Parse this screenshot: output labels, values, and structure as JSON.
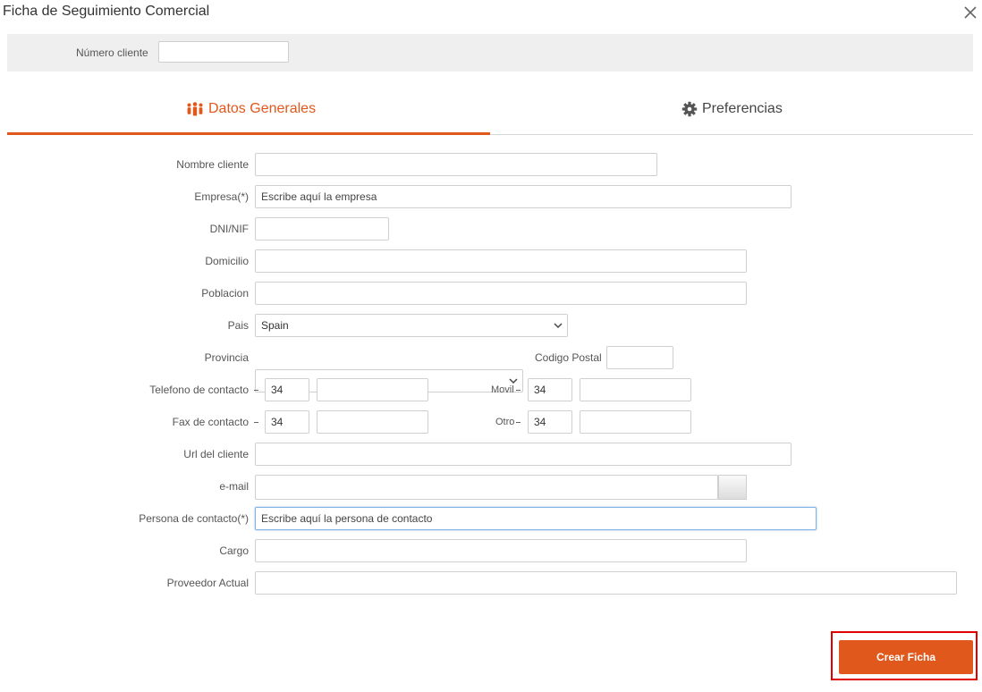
{
  "dialog": {
    "title": "Ficha de Seguimiento Comercial",
    "close_icon": "close-icon"
  },
  "client_search": {
    "label": "Número cliente",
    "value": ""
  },
  "tabs": [
    {
      "label": "Datos Generales",
      "icon": "users-icon",
      "active": true
    },
    {
      "label": "Preferencias",
      "icon": "gear-icon",
      "active": false
    }
  ],
  "form": {
    "nombre_cliente": {
      "label": "Nombre cliente",
      "value": ""
    },
    "empresa": {
      "label": "Empresa(*)",
      "placeholder": "Escribe aquí la empresa"
    },
    "dni": {
      "label": "DNI/NIF",
      "value": ""
    },
    "domicilio": {
      "label": "Domicilio",
      "value": ""
    },
    "poblacion": {
      "label": "Poblacion",
      "value": ""
    },
    "pais": {
      "label": "Pais",
      "value": "Spain"
    },
    "provincia": {
      "label": "Provincia",
      "value": ""
    },
    "codigo_postal": {
      "label": "Codigo Postal",
      "value": ""
    },
    "telefono": {
      "label": "Telefono de contacto",
      "prefix": "34",
      "value": ""
    },
    "movil": {
      "label": "Movil",
      "prefix": "34",
      "value": ""
    },
    "fax": {
      "label": "Fax de contacto",
      "prefix": "34",
      "value": ""
    },
    "otro": {
      "label": "Otro",
      "prefix": "34",
      "value": ""
    },
    "url": {
      "label": "Url del cliente",
      "value": ""
    },
    "email": {
      "label": "e-mail",
      "value": ""
    },
    "persona_contacto": {
      "label": "Persona de contacto(*)",
      "placeholder": "Escribe aquí la persona de contacto"
    },
    "cargo": {
      "label": "Cargo",
      "value": ""
    },
    "proveedor": {
      "label": "Proveedor Actual",
      "value": ""
    }
  },
  "actions": {
    "submit_label": "Crear Ficha"
  },
  "colors": {
    "accent": "#e0581b",
    "highlight": "#e00000"
  }
}
